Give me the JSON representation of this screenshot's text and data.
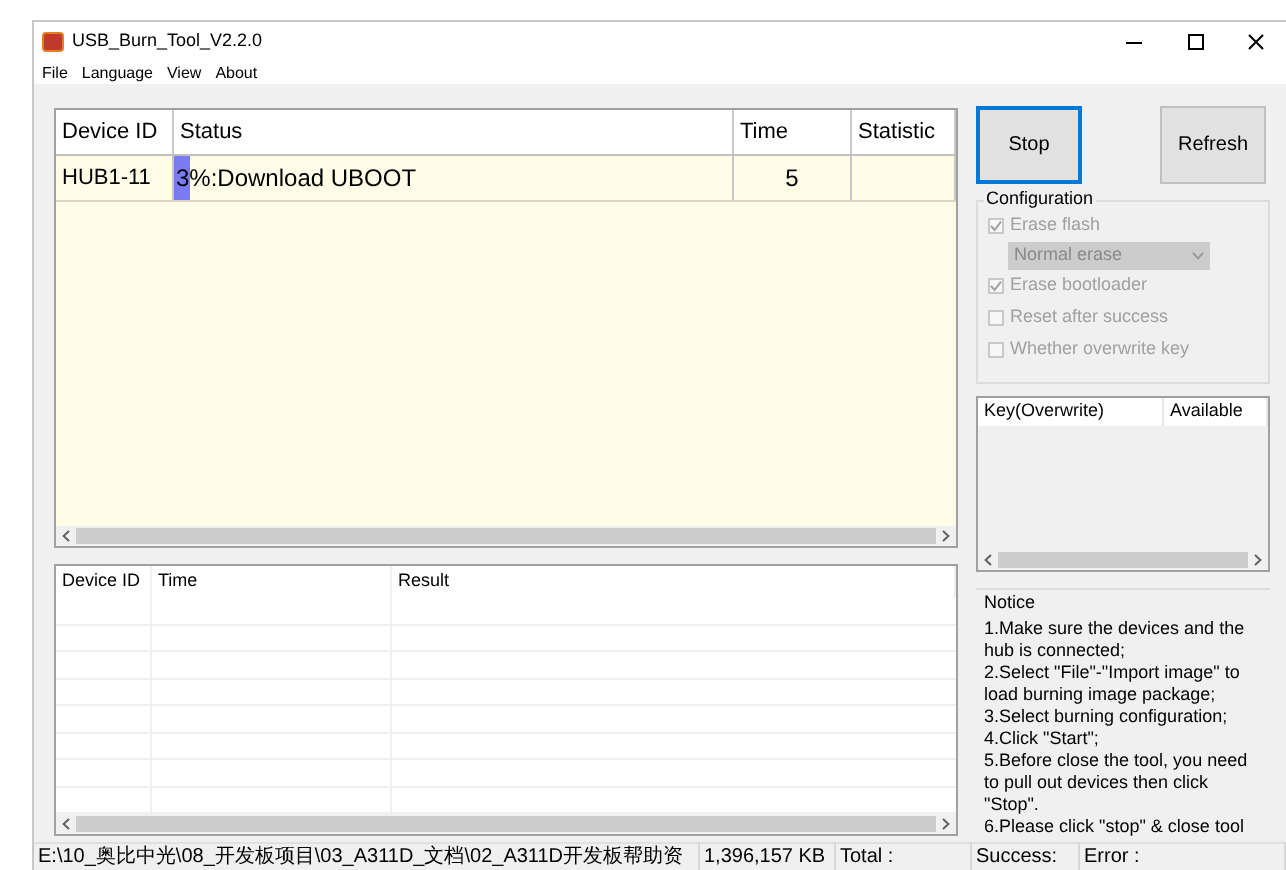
{
  "window": {
    "title": "USB_Burn_Tool_V2.2.0"
  },
  "menu": [
    "File",
    "Language",
    "View",
    "About"
  ],
  "device_table": {
    "columns": [
      "Device ID",
      "Status",
      "Time",
      "Statistic"
    ],
    "rows": [
      {
        "device_id": "HUB1-11",
        "status": "3%:Download UBOOT",
        "level": 0.03,
        "time": "5",
        "statistic": ""
      }
    ]
  },
  "log_table": {
    "columns": [
      "Device ID",
      "Time",
      "Result"
    ]
  },
  "buttons": [
    {
      "label": "Stop",
      "focused": true
    },
    {
      "label": "Refresh",
      "focused": false
    }
  ],
  "configuration": {
    "title": "Configuration",
    "items": [
      {
        "kind": "checkbox",
        "label": "Erase flash",
        "checked": true,
        "disabled": true
      },
      {
        "kind": "select",
        "value": "Normal erase",
        "disabled": true
      },
      {
        "kind": "checkbox",
        "label": "Erase bootloader",
        "checked": true,
        "disabled": true
      },
      {
        "kind": "checkbox",
        "label": "Reset after success",
        "checked": false,
        "disabled": true
      },
      {
        "kind": "checkbox",
        "label": "Whether overwrite key",
        "checked": false,
        "disabled": true
      }
    ]
  },
  "key_table": {
    "columns": [
      "Key(Overwrite)",
      "Available"
    ]
  },
  "notice": {
    "title": "Notice",
    "text": "1.Make sure the devices and the hub is connected;\n2.Select \"File\"-\"Import image\" to load burning image package;\n3.Select burning configuration;\n4.Click \"Start\";\n5.Before close the tool, you need to pull out devices then click \"Stop\".\n6.Please click \"stop\" & close tool"
  },
  "status_bar": [
    "E:\\10_奥比中光\\08_开发板项目\\03_A311D_文档\\02_A311D开发板帮助资",
    "1,396,157 KB",
    "Total :",
    "Success:",
    "Error :"
  ]
}
